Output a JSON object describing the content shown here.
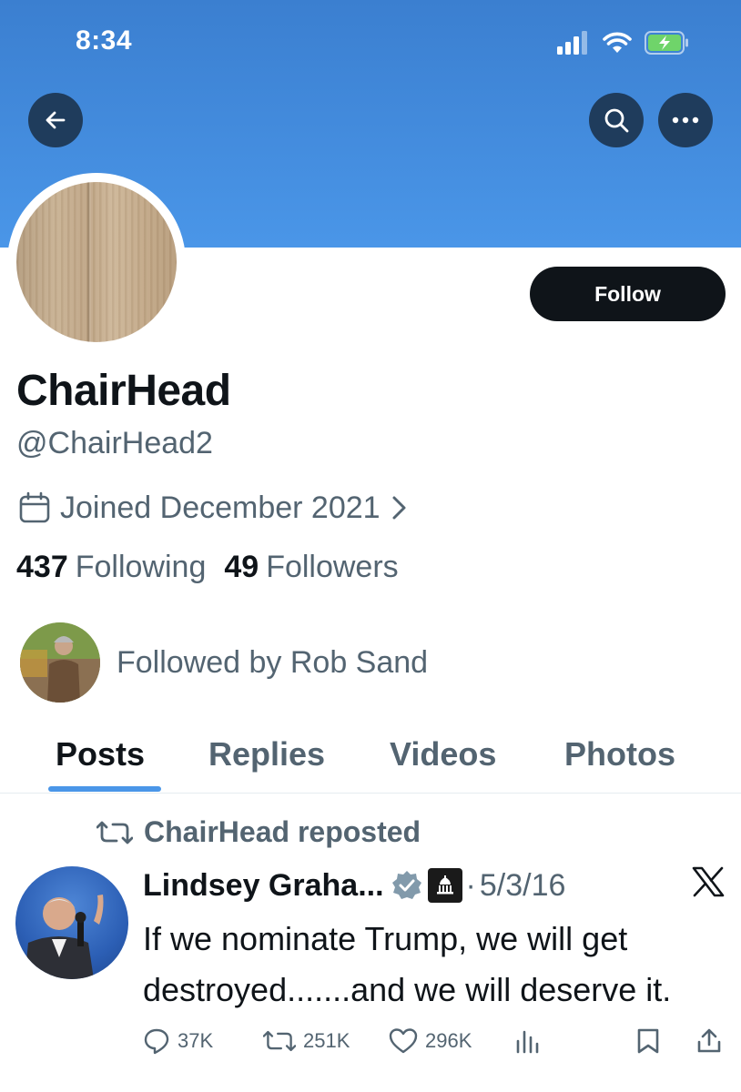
{
  "status_bar": {
    "time": "8:34"
  },
  "profile": {
    "display_name": "ChairHead",
    "handle": "@ChairHead2",
    "joined": "Joined December 2021",
    "following_count": "437",
    "following_label": "Following",
    "followers_count": "49",
    "followers_label": "Followers",
    "followed_by": "Followed by Rob Sand",
    "follow_label": "Follow"
  },
  "tabs": [
    {
      "label": "Posts",
      "active": true
    },
    {
      "label": "Replies",
      "active": false
    },
    {
      "label": "Videos",
      "active": false
    },
    {
      "label": "Photos",
      "active": false
    }
  ],
  "post": {
    "repost_label": "ChairHead reposted",
    "author": "Lindsey Graha...",
    "date": "5/3/16",
    "separator": "·",
    "text": "If we nominate Trump, we will get destroyed.......and we will deserve it.",
    "replies": "37K",
    "reposts": "251K",
    "likes": "296K"
  },
  "colors": {
    "banner": "#4a96e8",
    "tab_indicator": "#4a96e8",
    "verified_badge": "#829aab",
    "follow_button": "#0f1419"
  },
  "icons": [
    "back-arrow-icon",
    "search-icon",
    "more-icon",
    "calendar-icon",
    "chevron-right-icon",
    "repost-icon",
    "verified-icon",
    "government-building-icon",
    "x-logo-icon",
    "reply-icon",
    "like-icon",
    "views-icon",
    "bookmark-icon",
    "share-icon"
  ]
}
